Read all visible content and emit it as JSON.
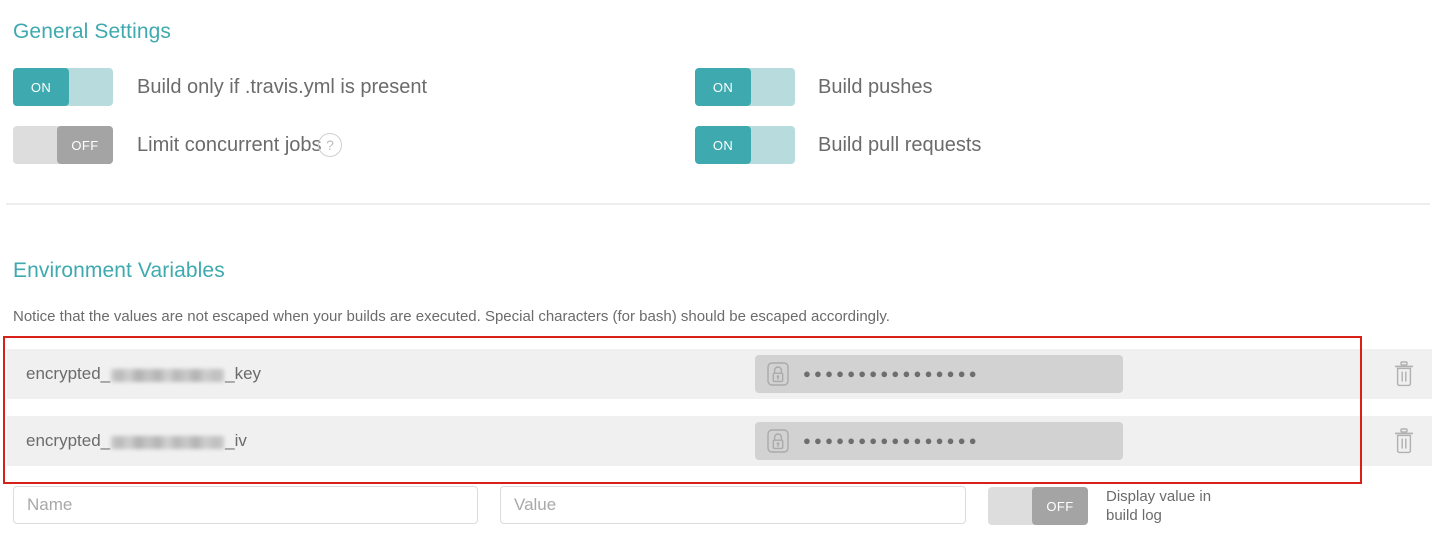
{
  "general": {
    "title": "General Settings",
    "toggles": [
      {
        "state": "ON",
        "label": "Build only if .travis.yml is present",
        "help": false
      },
      {
        "state": "OFF",
        "label": "Limit concurrent jobs",
        "help": true,
        "help_glyph": "?"
      },
      {
        "state": "ON",
        "label": "Build pushes",
        "help": false
      },
      {
        "state": "ON",
        "label": "Build pull requests",
        "help": false
      }
    ]
  },
  "environment": {
    "title": "Environment Variables",
    "notice": "Notice that the values are not escaped when your builds are executed. Special characters (for bash) should be escaped accordingly.",
    "rows": [
      {
        "name_prefix": "encrypted_",
        "name_redacted": true,
        "name_suffix": "_key",
        "value_masked": "●●●●●●●●●●●●●●●●",
        "delete_label": "Delete"
      },
      {
        "name_prefix": "encrypted_",
        "name_redacted": true,
        "name_suffix": "_iv",
        "value_masked": "●●●●●●●●●●●●●●●●",
        "delete_label": "Delete"
      }
    ],
    "form": {
      "name_placeholder": "Name",
      "name_value": "",
      "value_placeholder": "Value",
      "value_value": "",
      "display_toggle_state": "OFF",
      "display_label_line1": "Display value in",
      "display_label_line2": "build log"
    }
  },
  "colors": {
    "accent_teal": "#3eaaaf",
    "toggle_on_track": "#b8dcdd",
    "toggle_off_knob": "#a4a4a4",
    "toggle_off_track": "#dddddd",
    "highlight_red": "#d81f18",
    "row_background": "#f0f0f0",
    "value_pill": "#d2d2d2",
    "text": "#6b6b6b"
  }
}
